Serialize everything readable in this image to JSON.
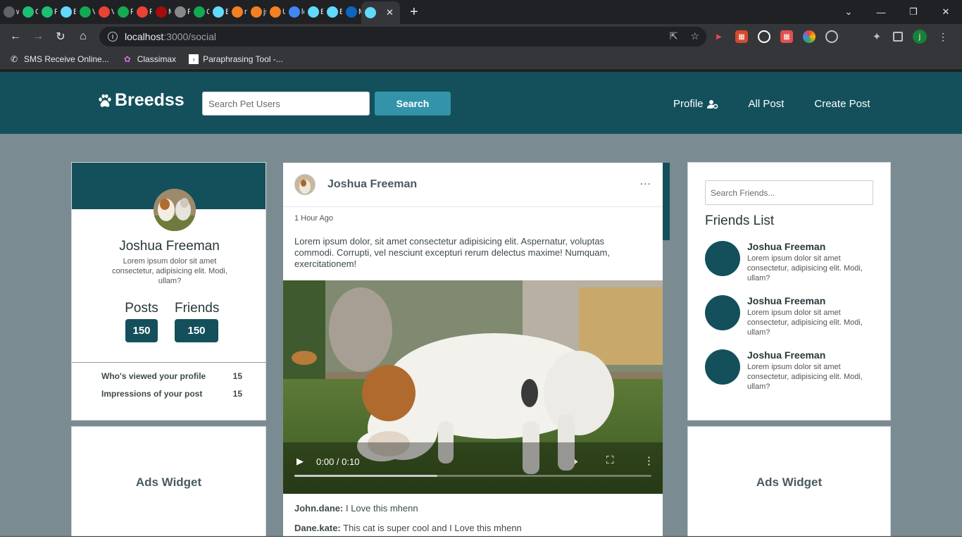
{
  "browser": {
    "tabs": [
      {
        "title": "ww",
        "icon": "globe-icon",
        "color": "#5f6368"
      },
      {
        "title": "Gi",
        "icon": "fiverr-icon",
        "color": "#1dbf73"
      },
      {
        "title": "Fiv",
        "icon": "fiverr-icon",
        "color": "#1dbf73"
      },
      {
        "title": "Bre",
        "icon": "react-icon",
        "color": "#61dafb"
      },
      {
        "title": "Ve",
        "icon": "mongodb-leaf-icon",
        "color": "#13aa52"
      },
      {
        "title": "Ve",
        "icon": "gmail-icon",
        "color": "#ea4335"
      },
      {
        "title": "Re",
        "icon": "mongodb-leaf-icon",
        "color": "#13aa52"
      },
      {
        "title": "Pa",
        "icon": "gmail-icon",
        "color": "#ea4335"
      },
      {
        "title": "Mc",
        "icon": "tab-icon",
        "color": "#a50e0e"
      },
      {
        "title": "Re",
        "icon": "avatar-icon",
        "color": "#888888"
      },
      {
        "title": "Clc",
        "icon": "mongodb-leaf-icon",
        "color": "#13aa52"
      },
      {
        "title": "Bre",
        "icon": "react-icon",
        "color": "#61dafb"
      },
      {
        "title": "no",
        "icon": "stackoverflow-icon",
        "color": "#f48024"
      },
      {
        "title": "jso",
        "icon": "stackoverflow-icon",
        "color": "#f48024"
      },
      {
        "title": "Us",
        "icon": "stackoverflow-icon",
        "color": "#f48024"
      },
      {
        "title": "loc",
        "icon": "google-icon",
        "color": "#4285f4"
      },
      {
        "title": "Bre",
        "icon": "react-icon",
        "color": "#61dafb"
      },
      {
        "title": "Bre",
        "icon": "react-icon",
        "color": "#61dafb"
      },
      {
        "title": "Mc",
        "icon": "linkedin-icon",
        "color": "#0a66c2"
      }
    ],
    "url_host": "localhost",
    "url_path": ":3000/social",
    "bookmarks": [
      {
        "label": "SMS Receive Online..."
      },
      {
        "label": "Classimax"
      },
      {
        "label": "Paraphrasing Tool -..."
      }
    ],
    "profile_initial": "j"
  },
  "header": {
    "logo": "Breedss",
    "search_placeholder": "Search Pet Users",
    "search_button": "Search",
    "nav": {
      "profile": "Profile",
      "all_post": "All Post",
      "create_post": "Create Post"
    }
  },
  "profile": {
    "name": "Joshua Freeman",
    "bio": "Lorem ipsum dolor sit amet consectetur, adipisicing elit. Modi, ullam?",
    "posts_label": "Posts",
    "posts_count": "150",
    "friends_label": "Friends",
    "friends_count": "150",
    "rows": [
      {
        "label": "Who's viewed your profile",
        "value": "15"
      },
      {
        "label": "Impressions of your post",
        "value": "15"
      }
    ]
  },
  "ads": {
    "left": "Ads Widget",
    "right": "Ads Widget"
  },
  "post": {
    "author": "Joshua Freeman",
    "more": "...",
    "time": "1 Hour Ago",
    "text": "Lorem ipsum dolor, sit amet consectetur adipisicing elit. Aspernatur, voluptas commodi. Corrupti, vel nesciunt excepturi rerum delectus maxime! Numquam, exercitationem!",
    "video": {
      "time": "0:00 / 0:10",
      "progress_fraction": 0.4
    },
    "comments": [
      {
        "user": "John.dane:",
        "text": "I Love this mhenn"
      },
      {
        "user": "Dane.kate:",
        "text": "This cat is super cool and I Love this mhenn"
      }
    ]
  },
  "friends": {
    "search_placeholder": "Search Friends...",
    "title": "Friends List",
    "items": [
      {
        "name": "Joshua Freeman",
        "bio": "Lorem ipsum dolor sit amet consectetur, adipisicing elit. Modi, ullam?"
      },
      {
        "name": "Joshua Freeman",
        "bio": "Lorem ipsum dolor sit amet consectetur, adipisicing elit. Modi, ullam?"
      },
      {
        "name": "Joshua Freeman",
        "bio": "Lorem ipsum dolor sit amet consectetur, adipisicing elit. Modi, ullam?"
      }
    ]
  },
  "colors": {
    "brand": "#13505b",
    "accent": "#3393a8",
    "page_bg": "#7a8c91"
  }
}
